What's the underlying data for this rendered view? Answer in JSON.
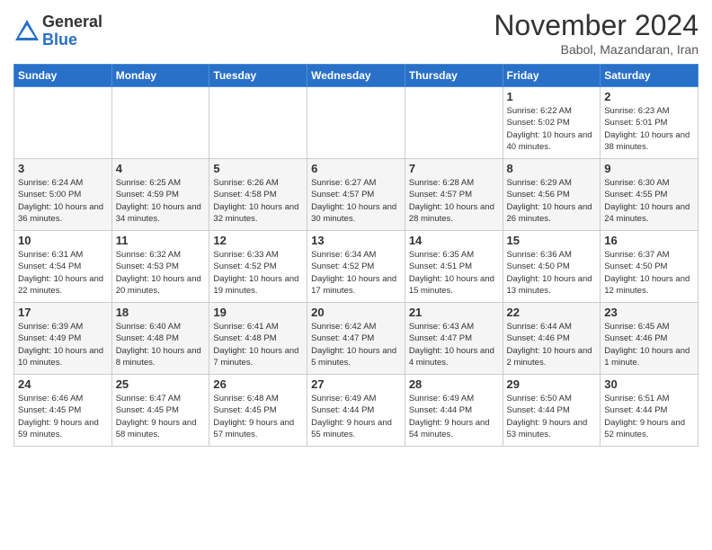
{
  "logo": {
    "general": "General",
    "blue": "Blue"
  },
  "title": "November 2024",
  "subtitle": "Babol, Mazandaran, Iran",
  "headers": [
    "Sunday",
    "Monday",
    "Tuesday",
    "Wednesday",
    "Thursday",
    "Friday",
    "Saturday"
  ],
  "weeks": [
    [
      {
        "day": "",
        "info": ""
      },
      {
        "day": "",
        "info": ""
      },
      {
        "day": "",
        "info": ""
      },
      {
        "day": "",
        "info": ""
      },
      {
        "day": "",
        "info": ""
      },
      {
        "day": "1",
        "info": "Sunrise: 6:22 AM\nSunset: 5:02 PM\nDaylight: 10 hours and 40 minutes."
      },
      {
        "day": "2",
        "info": "Sunrise: 6:23 AM\nSunset: 5:01 PM\nDaylight: 10 hours and 38 minutes."
      }
    ],
    [
      {
        "day": "3",
        "info": "Sunrise: 6:24 AM\nSunset: 5:00 PM\nDaylight: 10 hours and 36 minutes."
      },
      {
        "day": "4",
        "info": "Sunrise: 6:25 AM\nSunset: 4:59 PM\nDaylight: 10 hours and 34 minutes."
      },
      {
        "day": "5",
        "info": "Sunrise: 6:26 AM\nSunset: 4:58 PM\nDaylight: 10 hours and 32 minutes."
      },
      {
        "day": "6",
        "info": "Sunrise: 6:27 AM\nSunset: 4:57 PM\nDaylight: 10 hours and 30 minutes."
      },
      {
        "day": "7",
        "info": "Sunrise: 6:28 AM\nSunset: 4:57 PM\nDaylight: 10 hours and 28 minutes."
      },
      {
        "day": "8",
        "info": "Sunrise: 6:29 AM\nSunset: 4:56 PM\nDaylight: 10 hours and 26 minutes."
      },
      {
        "day": "9",
        "info": "Sunrise: 6:30 AM\nSunset: 4:55 PM\nDaylight: 10 hours and 24 minutes."
      }
    ],
    [
      {
        "day": "10",
        "info": "Sunrise: 6:31 AM\nSunset: 4:54 PM\nDaylight: 10 hours and 22 minutes."
      },
      {
        "day": "11",
        "info": "Sunrise: 6:32 AM\nSunset: 4:53 PM\nDaylight: 10 hours and 20 minutes."
      },
      {
        "day": "12",
        "info": "Sunrise: 6:33 AM\nSunset: 4:52 PM\nDaylight: 10 hours and 19 minutes."
      },
      {
        "day": "13",
        "info": "Sunrise: 6:34 AM\nSunset: 4:52 PM\nDaylight: 10 hours and 17 minutes."
      },
      {
        "day": "14",
        "info": "Sunrise: 6:35 AM\nSunset: 4:51 PM\nDaylight: 10 hours and 15 minutes."
      },
      {
        "day": "15",
        "info": "Sunrise: 6:36 AM\nSunset: 4:50 PM\nDaylight: 10 hours and 13 minutes."
      },
      {
        "day": "16",
        "info": "Sunrise: 6:37 AM\nSunset: 4:50 PM\nDaylight: 10 hours and 12 minutes."
      }
    ],
    [
      {
        "day": "17",
        "info": "Sunrise: 6:39 AM\nSunset: 4:49 PM\nDaylight: 10 hours and 10 minutes."
      },
      {
        "day": "18",
        "info": "Sunrise: 6:40 AM\nSunset: 4:48 PM\nDaylight: 10 hours and 8 minutes."
      },
      {
        "day": "19",
        "info": "Sunrise: 6:41 AM\nSunset: 4:48 PM\nDaylight: 10 hours and 7 minutes."
      },
      {
        "day": "20",
        "info": "Sunrise: 6:42 AM\nSunset: 4:47 PM\nDaylight: 10 hours and 5 minutes."
      },
      {
        "day": "21",
        "info": "Sunrise: 6:43 AM\nSunset: 4:47 PM\nDaylight: 10 hours and 4 minutes."
      },
      {
        "day": "22",
        "info": "Sunrise: 6:44 AM\nSunset: 4:46 PM\nDaylight: 10 hours and 2 minutes."
      },
      {
        "day": "23",
        "info": "Sunrise: 6:45 AM\nSunset: 4:46 PM\nDaylight: 10 hours and 1 minute."
      }
    ],
    [
      {
        "day": "24",
        "info": "Sunrise: 6:46 AM\nSunset: 4:45 PM\nDaylight: 9 hours and 59 minutes."
      },
      {
        "day": "25",
        "info": "Sunrise: 6:47 AM\nSunset: 4:45 PM\nDaylight: 9 hours and 58 minutes."
      },
      {
        "day": "26",
        "info": "Sunrise: 6:48 AM\nSunset: 4:45 PM\nDaylight: 9 hours and 57 minutes."
      },
      {
        "day": "27",
        "info": "Sunrise: 6:49 AM\nSunset: 4:44 PM\nDaylight: 9 hours and 55 minutes."
      },
      {
        "day": "28",
        "info": "Sunrise: 6:49 AM\nSunset: 4:44 PM\nDaylight: 9 hours and 54 minutes."
      },
      {
        "day": "29",
        "info": "Sunrise: 6:50 AM\nSunset: 4:44 PM\nDaylight: 9 hours and 53 minutes."
      },
      {
        "day": "30",
        "info": "Sunrise: 6:51 AM\nSunset: 4:44 PM\nDaylight: 9 hours and 52 minutes."
      }
    ]
  ]
}
